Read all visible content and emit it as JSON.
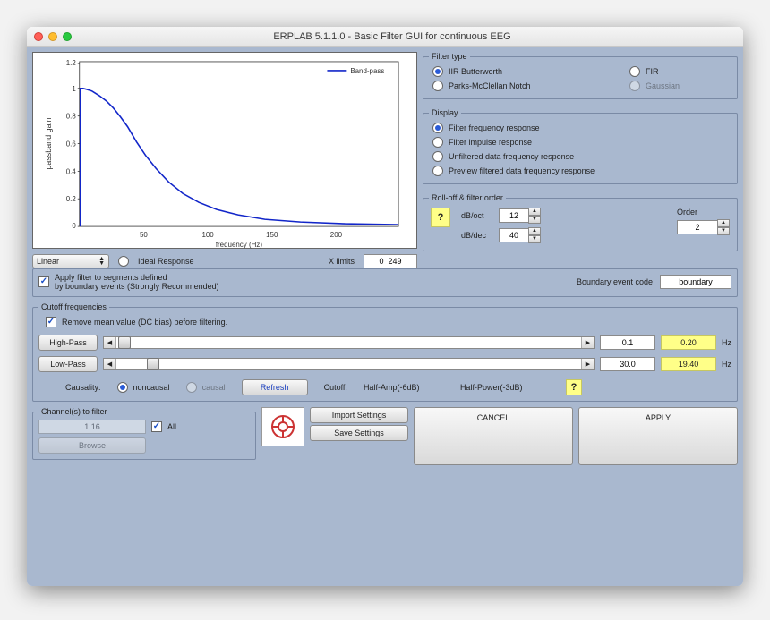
{
  "window": {
    "title": "ERPLAB 5.1.1.0   -   Basic Filter GUI for continuous EEG"
  },
  "plot": {
    "legend": "Band-pass",
    "ylabel": "passband gain",
    "xlabel": "frequency (Hz)",
    "xticks": [
      "50",
      "100",
      "150",
      "200"
    ],
    "yticks": [
      "0",
      "0.2",
      "0.4",
      "0.6",
      "0.8",
      "1",
      "1.2"
    ],
    "scale_select": "Linear",
    "ideal_label": "Ideal Response",
    "xlimits_label": "X limits",
    "xlimits_value": "0  249"
  },
  "filter_type": {
    "legend": "Filter type",
    "iir": "IIR Butterworth",
    "fir": "FIR",
    "pm": "Parks-McClellan Notch",
    "gauss": "Gaussian"
  },
  "display": {
    "legend": "Display",
    "freq": "Filter frequency response",
    "imp": "Filter impulse response",
    "unf": "Unfiltered data frequency response",
    "prev": "Preview filtered data frequency response"
  },
  "rolloff": {
    "legend": "Roll-off & filter order",
    "dboct": "dB/oct",
    "dboct_val": "12",
    "dbdec": "dB/dec",
    "dbdec_val": "40",
    "order": "Order",
    "order_val": "2",
    "help": "?"
  },
  "boundary": {
    "apply_label": "Apply filter to segments defined\nby boundary events (Strongly Recommended)",
    "code_label": "Boundary event code",
    "code_value": "boundary"
  },
  "cutoff": {
    "legend": "Cutoff frequencies",
    "remove_dc": "Remove mean value (DC bias) before filtering.",
    "hp_btn": "High-Pass",
    "hp_val": "0.1",
    "hp_half": "0.20",
    "lp_btn": "Low-Pass",
    "lp_val": "30.0",
    "lp_half": "19.40",
    "hz": "Hz",
    "causality": "Causality:",
    "noncausal": "noncausal",
    "causal": "causal",
    "refresh": "Refresh",
    "cutoff_label": "Cutoff:",
    "halfamp": "Half-Amp(-6dB)",
    "halfpow": "Half-Power(-3dB)",
    "help": "?"
  },
  "channels": {
    "legend": "Channel(s) to filter",
    "value": "1:16",
    "all": "All",
    "browse": "Browse"
  },
  "buttons": {
    "import": "Import Settings",
    "save": "Save Settings",
    "cancel": "CANCEL",
    "apply": "APPLY"
  },
  "chart_data": {
    "type": "line",
    "title": "Band-pass",
    "xlabel": "frequency (Hz)",
    "ylabel": "passband gain",
    "xlim": [
      0,
      249
    ],
    "ylim": [
      0,
      1.2
    ],
    "series": [
      {
        "name": "Band-pass",
        "x": [
          0,
          0.1,
          1,
          3,
          5,
          10,
          15,
          20,
          25,
          30,
          40,
          50,
          60,
          80,
          100,
          120,
          150,
          180,
          210,
          249
        ],
        "y": [
          0,
          1.0,
          1.0,
          0.99,
          0.98,
          0.95,
          0.9,
          0.82,
          0.72,
          0.61,
          0.42,
          0.29,
          0.21,
          0.12,
          0.07,
          0.045,
          0.025,
          0.015,
          0.01,
          0.005
        ]
      }
    ]
  }
}
